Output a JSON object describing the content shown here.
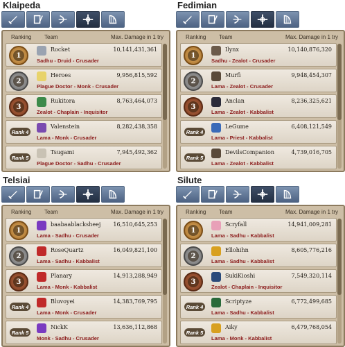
{
  "header": {
    "ranking": "Ranking",
    "team": "Team",
    "max_damage": "Max. Damage in 1 try"
  },
  "tabs": [
    "sword-icon",
    "book-quill-icon",
    "bow-icon",
    "crosshair-icon",
    "harp-icon"
  ],
  "panels": [
    {
      "server": "Klaipeda",
      "rows": [
        {
          "rank": "1",
          "name": "Rocket",
          "damage": "10,141,431,361",
          "comp": "Sadhu - Druid - Crusader",
          "avatar_color": "#9aa3b1"
        },
        {
          "rank": "2",
          "name": "Heroes",
          "damage": "9,956,815,592",
          "comp": "Plague Doctor - Monk - Crusader",
          "avatar_color": "#e8d36a"
        },
        {
          "rank": "3",
          "name": "Rukitora",
          "damage": "8,763,464,073",
          "comp": "Zealot - Chaplain - Inquisitor",
          "avatar_color": "#3c8a4a"
        },
        {
          "rank": "Rank 4",
          "name": "Valenstein",
          "damage": "8,282,438,358",
          "comp": "Lama - Monk - Crusader",
          "avatar_color": "#7a4ab0"
        },
        {
          "rank": "Rank 5",
          "name": "Tsugami",
          "damage": "7,945,492,362",
          "comp": "Plague Doctor - Sadhu - Crusader",
          "avatar_color": "#c9c2b4"
        }
      ]
    },
    {
      "server": "Fedimian",
      "rows": [
        {
          "rank": "1",
          "name": "Ilynx",
          "damage": "10,140,876,320",
          "comp": "Sadhu - Zealot - Crusader",
          "avatar_color": "#6b5a4a"
        },
        {
          "rank": "2",
          "name": "Murfi",
          "damage": "9,948,454,307",
          "comp": "Lama - Zealot - Crusader",
          "avatar_color": "#5a4a3a"
        },
        {
          "rank": "3",
          "name": "Anclan",
          "damage": "8,236,325,621",
          "comp": "Lama - Zealot - Kabbalist",
          "avatar_color": "#2b2b3a"
        },
        {
          "rank": "Rank 4",
          "name": "LeGume",
          "damage": "6,408,121,549",
          "comp": "Lama - Priest - Kabbalist",
          "avatar_color": "#3a6ab8"
        },
        {
          "rank": "Rank 5",
          "name": "DevilsCompanion",
          "damage": "4,739,016,705",
          "comp": "Lama - Zealot - Kabbalist",
          "avatar_color": "#5a4a3a"
        }
      ]
    },
    {
      "server": "Telsiai",
      "rows": [
        {
          "rank": "1",
          "name": "baabaablacksheej",
          "damage": "16,510,645,253",
          "comp": "Lama - Sadhu - Crusader",
          "avatar_color": "#7a3ac0"
        },
        {
          "rank": "2",
          "name": "RoseQuartz",
          "damage": "16,049,821,100",
          "comp": "Lama - Sadhu - Kabbalist",
          "avatar_color": "#c02a2a"
        },
        {
          "rank": "3",
          "name": "Planary",
          "damage": "14,913,288,949",
          "comp": "Lama - Monk - Kabbalist",
          "avatar_color": "#c02a2a"
        },
        {
          "rank": "Rank 4",
          "name": "Bluvoyei",
          "damage": "14,383,769,795",
          "comp": "Lama - Monk - Crusader",
          "avatar_color": "#c02a2a"
        },
        {
          "rank": "Rank 5",
          "name": "NickK",
          "damage": "13,636,112,868",
          "comp": "Monk - Sadhu - Crusader",
          "avatar_color": "#7a3ac0"
        }
      ]
    },
    {
      "server": "Silute",
      "rows": [
        {
          "rank": "1",
          "name": "Scryfall",
          "damage": "14,941,009,281",
          "comp": "Lama - Sadhu - Kabbalist",
          "avatar_color": "#e8a0b8"
        },
        {
          "rank": "2",
          "name": "Ellohihn",
          "damage": "8,605,776,216",
          "comp": "Lama - Sadhu - Kabbalist",
          "avatar_color": "#d8a020"
        },
        {
          "rank": "3",
          "name": "SukiKioshi",
          "damage": "7,549,320,114",
          "comp": "Zealot - Chaplain - Inquisitor",
          "avatar_color": "#2a4a7a"
        },
        {
          "rank": "Rank 4",
          "name": "Scriptyze",
          "damage": "6,772,499,685",
          "comp": "Lama - Sadhu - Kabbalist",
          "avatar_color": "#2a6a3a"
        },
        {
          "rank": "Rank 5",
          "name": "Aiky",
          "damage": "6,479,768,054",
          "comp": "Lama - Monk - Kabbalist",
          "avatar_color": "#d8a020"
        }
      ]
    }
  ]
}
